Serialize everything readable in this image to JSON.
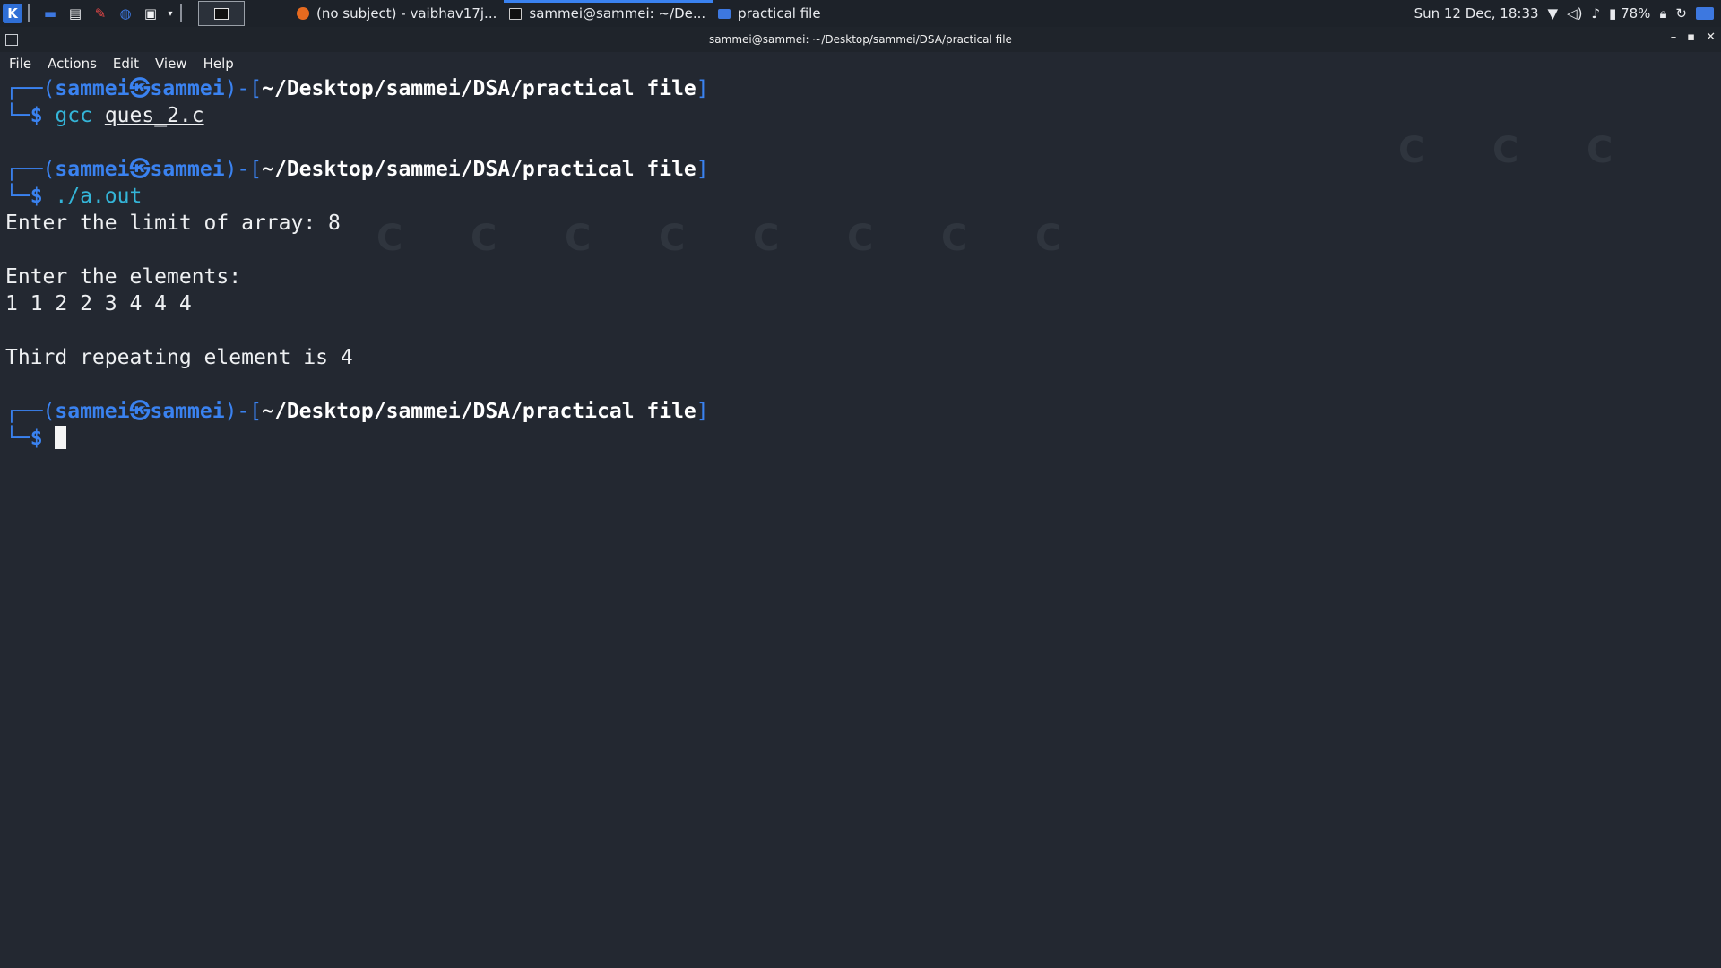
{
  "panel": {
    "tasks": [
      {
        "label": "(no subject) - vaibhav17j...",
        "icon": "firefox-icon"
      },
      {
        "label": "sammei@sammei: ~/De...",
        "icon": "terminal-icon"
      },
      {
        "label": "practical file",
        "icon": "folder-icon"
      }
    ],
    "clock": "Sun 12 Dec, 18:33",
    "battery": "78%"
  },
  "window": {
    "title": "sammei@sammei: ~/Desktop/sammei/DSA/practical file"
  },
  "menu": [
    "File",
    "Actions",
    "Edit",
    "View",
    "Help"
  ],
  "terminal": {
    "user": "sammei",
    "host": "sammei",
    "at_symbol": "㉿",
    "cwd": "~/Desktop/sammei/DSA/practical file",
    "prompt_symbol": "$",
    "cmd1": "gcc",
    "cmd1_arg": "ques_2.c",
    "cmd2": "./a.out",
    "out1": "Enter the limit of array: 8",
    "out2": "Enter the elements:",
    "out3": "1 1 2 2 3 4 4 4",
    "out4": "Third repeating element is 4"
  },
  "colors": {
    "accent": "#3a82f0",
    "background": "#232831",
    "command": "#34b5d8"
  }
}
